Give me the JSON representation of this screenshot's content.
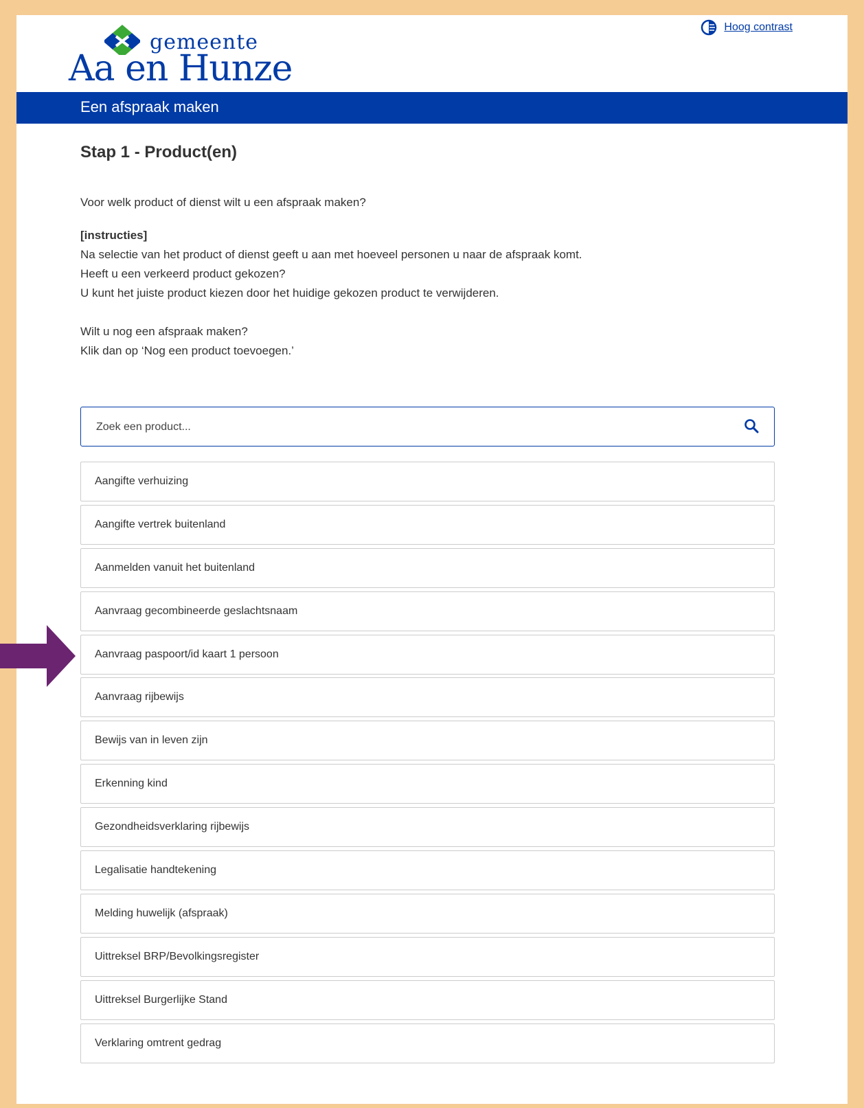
{
  "header": {
    "logo_small": "gemeente",
    "logo_name": "Aa en Hunze",
    "contrast_link": "Hoog contrast",
    "contrast_icon": "contrast-icon"
  },
  "banner": {
    "title": "Een afspraak maken"
  },
  "step": {
    "title": "Stap 1 - Product(en)",
    "question": "Voor welk product of dienst wilt u een afspraak maken?",
    "instructions_heading": "[instructies]",
    "instructions_lines": [
      "Na selectie van het product of dienst geeft u aan met hoeveel personen u naar de afspraak komt.",
      "Heeft u een verkeerd product gekozen?",
      "U kunt het juiste product kiezen door het huidige gekozen product te verwijderen."
    ],
    "more_lines": [
      "Wilt u nog een afspraak maken?",
      "Klik dan op ‘Nog een product toevoegen.’"
    ]
  },
  "search": {
    "placeholder": "Zoek een product...",
    "value": "",
    "icon": "search-icon"
  },
  "products": [
    "Aangifte verhuizing",
    "Aangifte vertrek buitenland",
    "Aanmelden vanuit het buitenland",
    "Aanvraag gecombineerde geslachtsnaam",
    "Aanvraag paspoort/id kaart 1 persoon",
    "Aanvraag rijbewijs",
    "Bewijs van in leven zijn",
    "Erkenning kind",
    "Gezondheidsverklaring rijbewijs",
    "Legalisatie handtekening",
    "Melding huwelijk (afspraak)",
    "Uittreksel BRP/Bevolkingsregister",
    "Uittreksel Burgerlijke Stand",
    "Verklaring omtrent gedrag"
  ],
  "annotation": {
    "icon": "arrow-right-icon",
    "color": "#6b2470",
    "points_to_product": "Aanvraag paspoort/id kaart 1 persoon"
  },
  "colors": {
    "brand_blue": "#003ba6",
    "brand_green": "#3aa935",
    "frame": "#f5cc94"
  }
}
